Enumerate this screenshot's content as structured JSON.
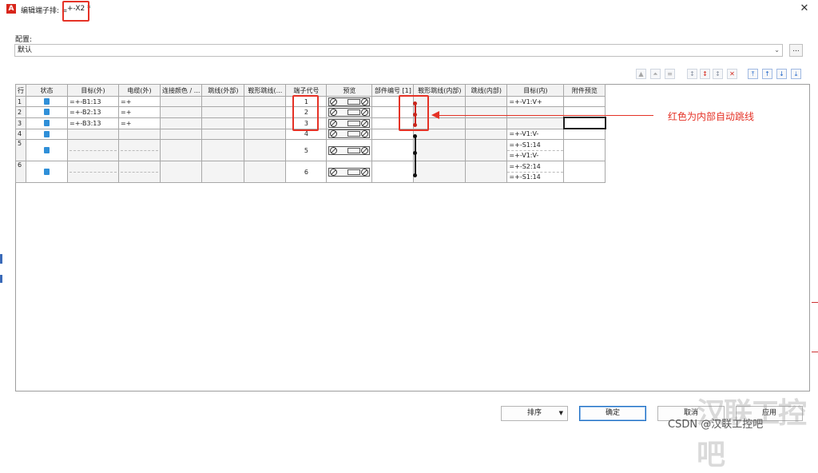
{
  "window": {
    "title": "编辑端子排: =",
    "title_name": "+-X2 *",
    "close_glyph": "✕"
  },
  "config": {
    "label": "配置:",
    "value": "默认",
    "more_label": "..."
  },
  "table": {
    "headers": [
      "行",
      "状态",
      "目标(外)",
      "电缆(外)",
      "连接颜色 / ...",
      "跳线(外部)",
      "鞍形跳线(...",
      "端子代号",
      "预览",
      "部件编号 [1]",
      "鞍形跳线(内部)",
      "跳线(内部)",
      "目标(内)",
      "附件预览"
    ],
    "rows": [
      {
        "row": "1",
        "target_out": "=+-B1:13",
        "cable_out": "=+",
        "terminal": "1",
        "target_in": "=+-V1:V+"
      },
      {
        "row": "2",
        "target_out": "=+-B2:13",
        "cable_out": "=+",
        "terminal": "2",
        "target_in": ""
      },
      {
        "row": "3",
        "target_out": "=+-B3:13",
        "cable_out": "=+",
        "terminal": "3",
        "target_in": ""
      },
      {
        "row": "4",
        "target_out": "",
        "cable_out": "",
        "terminal": "4",
        "target_in": "=+-V1:V-"
      },
      {
        "row": "5",
        "target_out": "",
        "cable_out": "",
        "terminal": "5",
        "target_in": "=+-S1:14",
        "target_in_2": "=+-V1:V-"
      },
      {
        "row": "6",
        "target_out": "",
        "cable_out": "",
        "terminal": "6",
        "target_in": "=+-S2:14",
        "target_in_2": "=+-S1:14"
      }
    ]
  },
  "annotation": {
    "text": "红色为内部自动跳线",
    "color": "#e53226"
  },
  "buttons": {
    "sort": "排序",
    "sort_arrow": "▼",
    "ok": "确定",
    "cancel": "取消",
    "apply": "应用"
  },
  "watermark": {
    "big": "汉联工控吧",
    "small": "CSDN @汉联工控吧"
  },
  "colors": {
    "accent_red": "#e53226",
    "status_blue": "#2f8fd8",
    "primary_blue": "#1d6fc4"
  }
}
